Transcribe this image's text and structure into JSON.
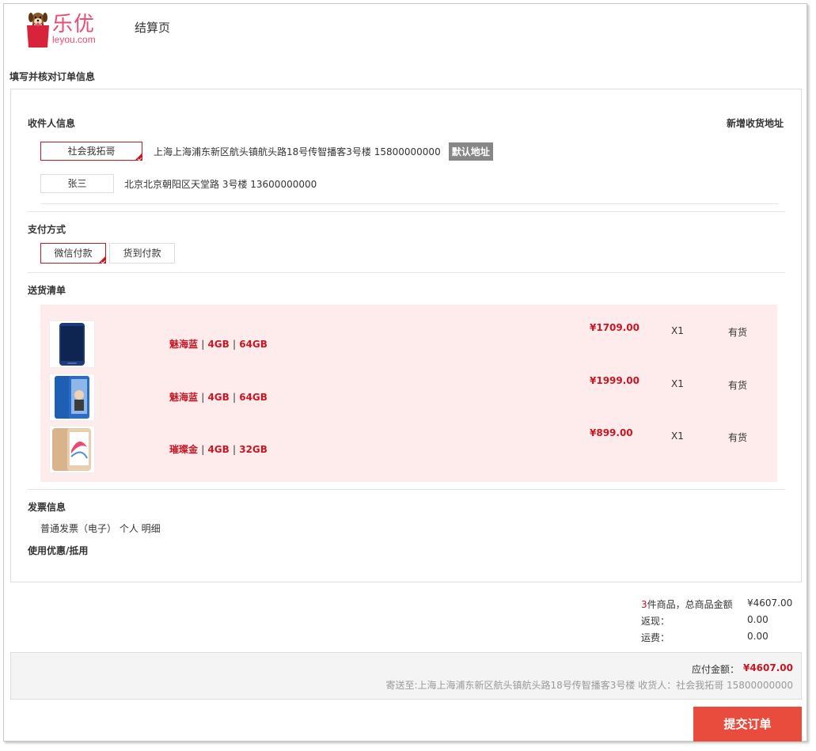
{
  "header": {
    "logo_brand": "乐优",
    "logo_domain": "leyou.com",
    "page_name": "结算页"
  },
  "section_title": "填写并核对订单信息",
  "receiver": {
    "title": "收件人信息",
    "add_link": "新增收货地址",
    "addresses": [
      {
        "name": "社会我拓哥",
        "detail": "上海上海浦东新区航头镇航头路18号传智播客3号楼 15800000000",
        "badge": "默认地址",
        "selected": true
      },
      {
        "name": "张三",
        "detail": "北京北京朝阳区天堂路 3号楼 13600000000",
        "selected": false
      }
    ]
  },
  "payment": {
    "title": "支付方式",
    "options": [
      "微信付款",
      "货到付款"
    ],
    "selected": "微信付款"
  },
  "delivery": {
    "title": "送货清单",
    "items": [
      {
        "color": "魅海蓝",
        "ram": "4GB",
        "rom": "64GB",
        "price": "¥1709.00",
        "qty": "X1",
        "stock": "有货",
        "thumb": "blue-phone"
      },
      {
        "color": "魅海蓝",
        "ram": "4GB",
        "rom": "64GB",
        "price": "¥1999.00",
        "qty": "X1",
        "stock": "有货",
        "thumb": "blue-phone-2"
      },
      {
        "color": "璀璨金",
        "ram": "4GB",
        "rom": "32GB",
        "price": "¥899.00",
        "qty": "X1",
        "stock": "有货",
        "thumb": "gold-phone"
      }
    ],
    "separator": "|"
  },
  "invoice": {
    "title": "发票信息",
    "detail": "普通发票（电子） 个人 明细"
  },
  "coupon": {
    "title": "使用优惠/抵用"
  },
  "summary": {
    "count": "3",
    "count_suffix": "件商品，总商品金额",
    "goods_total": "¥4607.00",
    "cashback_label": "返现：",
    "cashback": "0.00",
    "shipping_label": "运费：",
    "shipping": "0.00"
  },
  "total": {
    "label": "应付金额：",
    "value": "¥4607.00",
    "ship_to": "寄送至:上海上海浦东新区航头镇航头路18号传智播客3号楼 收货人：社会我拓哥 15800000000"
  },
  "submit_label": "提交订单",
  "colors": {
    "accent": "#c81623",
    "brand": "#e94c73",
    "submit": "#e94c3d",
    "goods_bg": "#feeced"
  }
}
